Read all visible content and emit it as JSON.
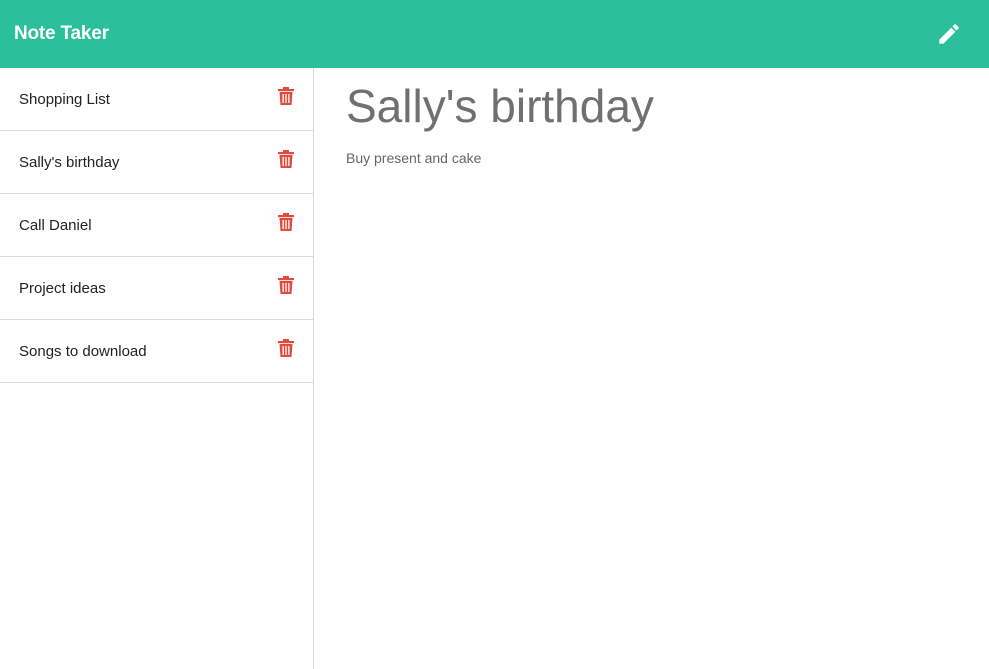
{
  "app": {
    "title": "Note Taker"
  },
  "toolbar": {
    "new_note_icon": "pencil-icon"
  },
  "sidebar": {
    "notes": [
      {
        "title": "Shopping List",
        "delete_icon": "trash-icon"
      },
      {
        "title": "Sally's birthday",
        "delete_icon": "trash-icon"
      },
      {
        "title": "Call Daniel",
        "delete_icon": "trash-icon"
      },
      {
        "title": "Project ideas",
        "delete_icon": "trash-icon"
      },
      {
        "title": "Songs to download",
        "delete_icon": "trash-icon"
      }
    ]
  },
  "active_note": {
    "title": "Sally's birthday",
    "body": "Buy present and cake"
  },
  "colors": {
    "brand": "#2bbf9c",
    "delete": "#e04b3f"
  }
}
